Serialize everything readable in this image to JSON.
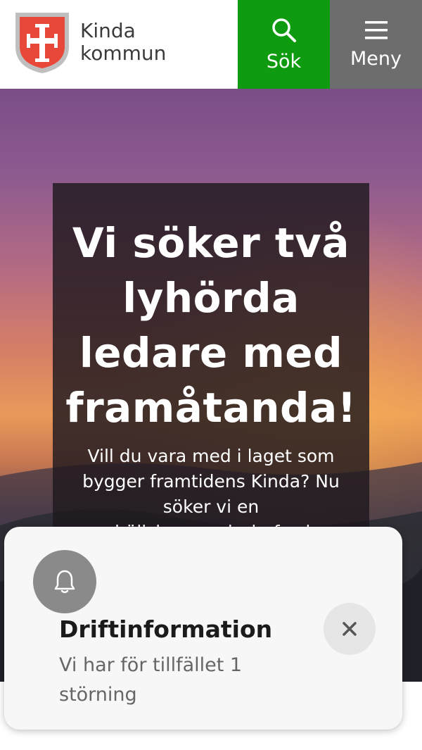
{
  "header": {
    "brand_line1": "Kinda",
    "brand_line2": "kommun",
    "search_label": "Sök",
    "menu_label": "Meny",
    "colors": {
      "search_bg": "#0f9b0f",
      "menu_bg": "#6d6d6d"
    },
    "icons": {
      "logo": "coat-of-arms-icon",
      "search": "search-icon",
      "menu": "hamburger-menu-icon"
    }
  },
  "hero": {
    "heading": "Vi söker två lyhörda ledare med framåtanda!",
    "body": "Vill du vara med i laget som bygger framtidens Kinda? Nu söker vi en samhällsbyggnadschef och en bildningschef som leder med ansvarskänsla, dialog och framåtanda! Här hittar"
  },
  "notification": {
    "title": "Driftinformation",
    "message": "Vi har för tillfället 1 störning",
    "icons": {
      "status": "bell-icon",
      "close": "close-icon"
    }
  }
}
